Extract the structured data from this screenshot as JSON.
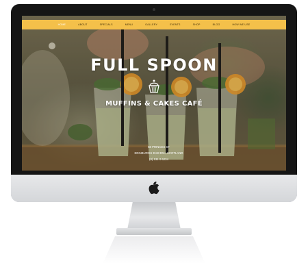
{
  "nav": {
    "items": [
      {
        "label": "Home"
      },
      {
        "label": "About"
      },
      {
        "label": "Specials"
      },
      {
        "label": "Menu"
      },
      {
        "label": "Gallery"
      },
      {
        "label": "Events"
      },
      {
        "label": "Shop"
      },
      {
        "label": "Blog"
      },
      {
        "label": "How we use"
      }
    ],
    "active_index": 0
  },
  "hero": {
    "title": "FULL SPOON",
    "subtitle": "MUFFINS & CAKES CAFÉ"
  },
  "address": {
    "line1": "58 PRINCES ST",
    "line2": "EDINBURGH EH8 3DH, SCOTLAND",
    "line3": "(0) 131 0 6234"
  },
  "colors": {
    "nav_bar": "#f4c04a",
    "nav_text": "#3d2c09",
    "nav_active_text": "#ffffff",
    "hero_text": "#ffffff"
  },
  "icons": {
    "hero_logo": "cupcake-icon",
    "monitor_logo": "apple-icon"
  }
}
